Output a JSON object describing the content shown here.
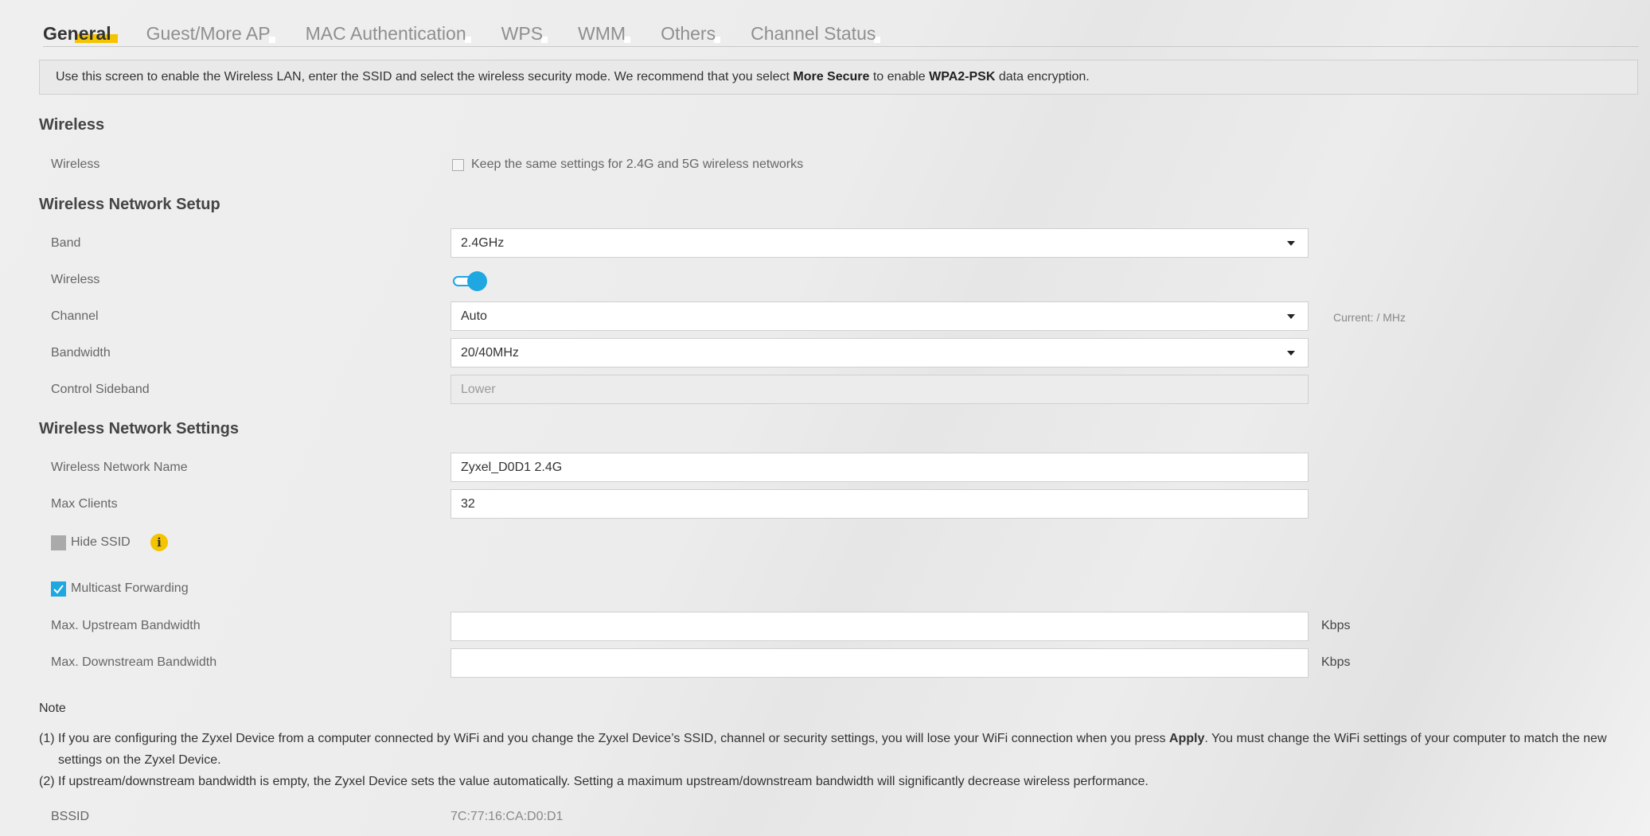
{
  "tabs": [
    {
      "label": "General",
      "active": true
    },
    {
      "label": "Guest/More AP",
      "active": false
    },
    {
      "label": "MAC Authentication",
      "active": false
    },
    {
      "label": "WPS",
      "active": false
    },
    {
      "label": "WMM",
      "active": false
    },
    {
      "label": "Others",
      "active": false
    },
    {
      "label": "Channel Status",
      "active": false
    }
  ],
  "intro": {
    "text_before": "Use this screen to enable the Wireless LAN, enter the SSID and select the wireless security mode. We recommend that you select ",
    "bold1": "More Secure",
    "text_mid": " to enable ",
    "bold2": "WPA2-PSK",
    "text_after": " data encryption."
  },
  "wireless_section": {
    "title": "Wireless",
    "row_label": "Wireless",
    "keep_same_label": "Keep the same settings for 2.4G and 5G wireless networks",
    "keep_same_checked": false
  },
  "setup_section": {
    "title": "Wireless Network Setup",
    "band_label": "Band",
    "band_value": "2.4GHz",
    "wireless_label": "Wireless",
    "wireless_enabled": true,
    "channel_label": "Channel",
    "channel_value": "Auto",
    "current_text": "Current: / MHz",
    "bandwidth_label": "Bandwidth",
    "bandwidth_value": "20/40MHz",
    "sideband_label": "Control Sideband",
    "sideband_value": "Lower"
  },
  "settings_section": {
    "title": "Wireless Network Settings",
    "name_label": "Wireless Network Name",
    "name_value": "Zyxel_D0D1 2.4G",
    "max_clients_label": "Max Clients",
    "max_clients_value": "32",
    "hide_ssid_label": "Hide SSID",
    "hide_ssid_checked": false,
    "multicast_label": "Multicast Forwarding",
    "multicast_checked": true,
    "upstream_label": "Max. Upstream Bandwidth",
    "upstream_value": "",
    "downstream_label": "Max. Downstream Bandwidth",
    "downstream_value": "",
    "unit": "Kbps"
  },
  "note": {
    "title": "Note",
    "line1_before": "(1) If you are configuring the Zyxel Device from a computer connected by WiFi and you change the Zyxel Device’s SSID, channel or security settings, you will lose your WiFi connection when you press ",
    "line1_bold": "Apply",
    "line1_after": ". You must change the WiFi settings of your computer to match the new",
    "line1_cont": "settings on the Zyxel Device.",
    "line2": "(2) If upstream/downstream bandwidth is empty, the Zyxel Device sets the value automatically. Setting a maximum upstream/downstream bandwidth will significantly decrease wireless performance."
  },
  "bssid": {
    "label": "BSSID",
    "value": "7C:77:16:CA:D0:D1"
  },
  "colors": {
    "accent_yellow": "#f5c400",
    "toggle_blue": "#1ea7e0"
  }
}
